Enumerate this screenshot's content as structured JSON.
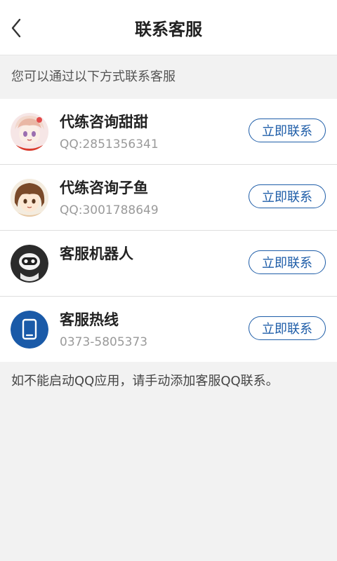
{
  "header": {
    "title": "联系客服"
  },
  "hint": "您可以通过以下方式联系客服",
  "contacts": [
    {
      "name": "代练咨询甜甜",
      "sub": "QQ:2851356341",
      "button": "立即联系"
    },
    {
      "name": "代练咨询子鱼",
      "sub": "QQ:3001788649",
      "button": "立即联系"
    },
    {
      "name": "客服机器人",
      "sub": "",
      "button": "立即联系"
    },
    {
      "name": "客服热线",
      "sub": "0373-5805373",
      "button": "立即联系"
    }
  ],
  "footer_note": "如不能启动QQ应用，请手动添加客服QQ联系。",
  "colors": {
    "accent": "#1e5da8",
    "hotline_icon_bg": "#1a5aa8",
    "background": "#f2f2f2"
  },
  "icons": [
    "back-chevron-icon",
    "avatar-tiantian",
    "avatar-ziyu",
    "robot-icon",
    "tablet-phone-icon"
  ]
}
